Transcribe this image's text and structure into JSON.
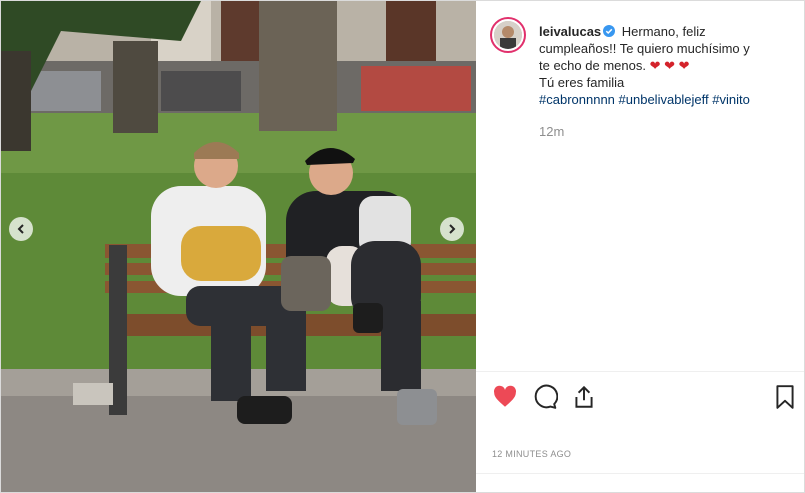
{
  "post": {
    "username": "leivalucas",
    "caption_line1": "Hermano, feliz",
    "caption_line2": "cumpleaños!! Te quiero muchísimo y",
    "caption_line3": "te echo de menos.",
    "caption_hearts": "❤ ❤ ❤",
    "caption_line4": "Tú eres familia",
    "hashtags": [
      "#cabronnnnn",
      "#unbelivablejeff",
      "#vinito"
    ],
    "comment_time": "12m",
    "date_label": "12 MINUTES AGO"
  },
  "icons": {
    "verified": "verified-badge-icon",
    "like": "heart-icon",
    "comment": "comment-icon",
    "share": "share-icon",
    "save": "bookmark-icon",
    "prev": "chevron-left-icon",
    "next": "chevron-right-icon"
  },
  "colors": {
    "like_red": "#ed4956",
    "link_blue": "#003569",
    "verified_blue": "#3897f0",
    "muted": "#8e8e8e"
  }
}
